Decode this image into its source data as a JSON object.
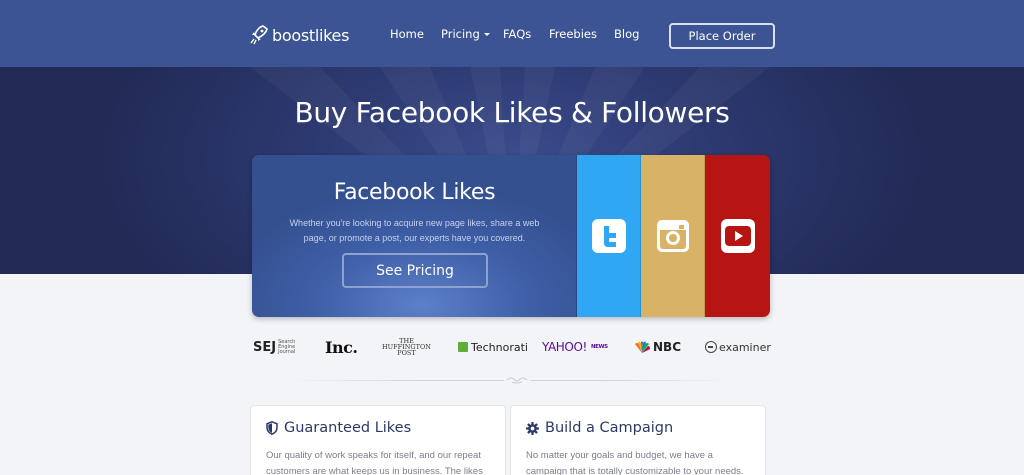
{
  "nav": {
    "logo_text": "boostlikes",
    "links": [
      "Home",
      "Pricing",
      "FAQs",
      "Freebies",
      "Blog"
    ],
    "cta": "Place Order"
  },
  "hero": {
    "title": "Buy Facebook Likes & Followers"
  },
  "card": {
    "title": "Facebook Likes",
    "description": "Whether you're looking to acquire new page likes, share a web page, or promote a post, our experts have you covered.",
    "button": "See Pricing",
    "tabs": [
      {
        "name": "Twitter",
        "icon": "twitter-icon",
        "color": "#2fa7f2"
      },
      {
        "name": "Instagram",
        "icon": "instagram-icon",
        "color": "#d7b267"
      },
      {
        "name": "YouTube",
        "icon": "youtube-icon",
        "color": "#b71414"
      }
    ]
  },
  "press": {
    "sej": "SEJ",
    "sej_sub": "Search Engine Journal",
    "inc": "Inc.",
    "huff": [
      "THE",
      "HUFFINGTON",
      "POST"
    ],
    "technorati": "Technorati",
    "yahoo": "YAHOO!",
    "yahoo_sub": "NEWS",
    "nbc": "NBC",
    "examiner": "examiner"
  },
  "features": [
    {
      "icon": "shield-icon",
      "title": "Guaranteed Likes",
      "text": "Our quality of work speaks for itself, and our repeat customers are what keeps us in business. The likes"
    },
    {
      "icon": "gear-icon",
      "title": "Build a Campaign",
      "text": "No matter your goals and budget, we have a campaign that is totally customizable to your needs."
    }
  ]
}
